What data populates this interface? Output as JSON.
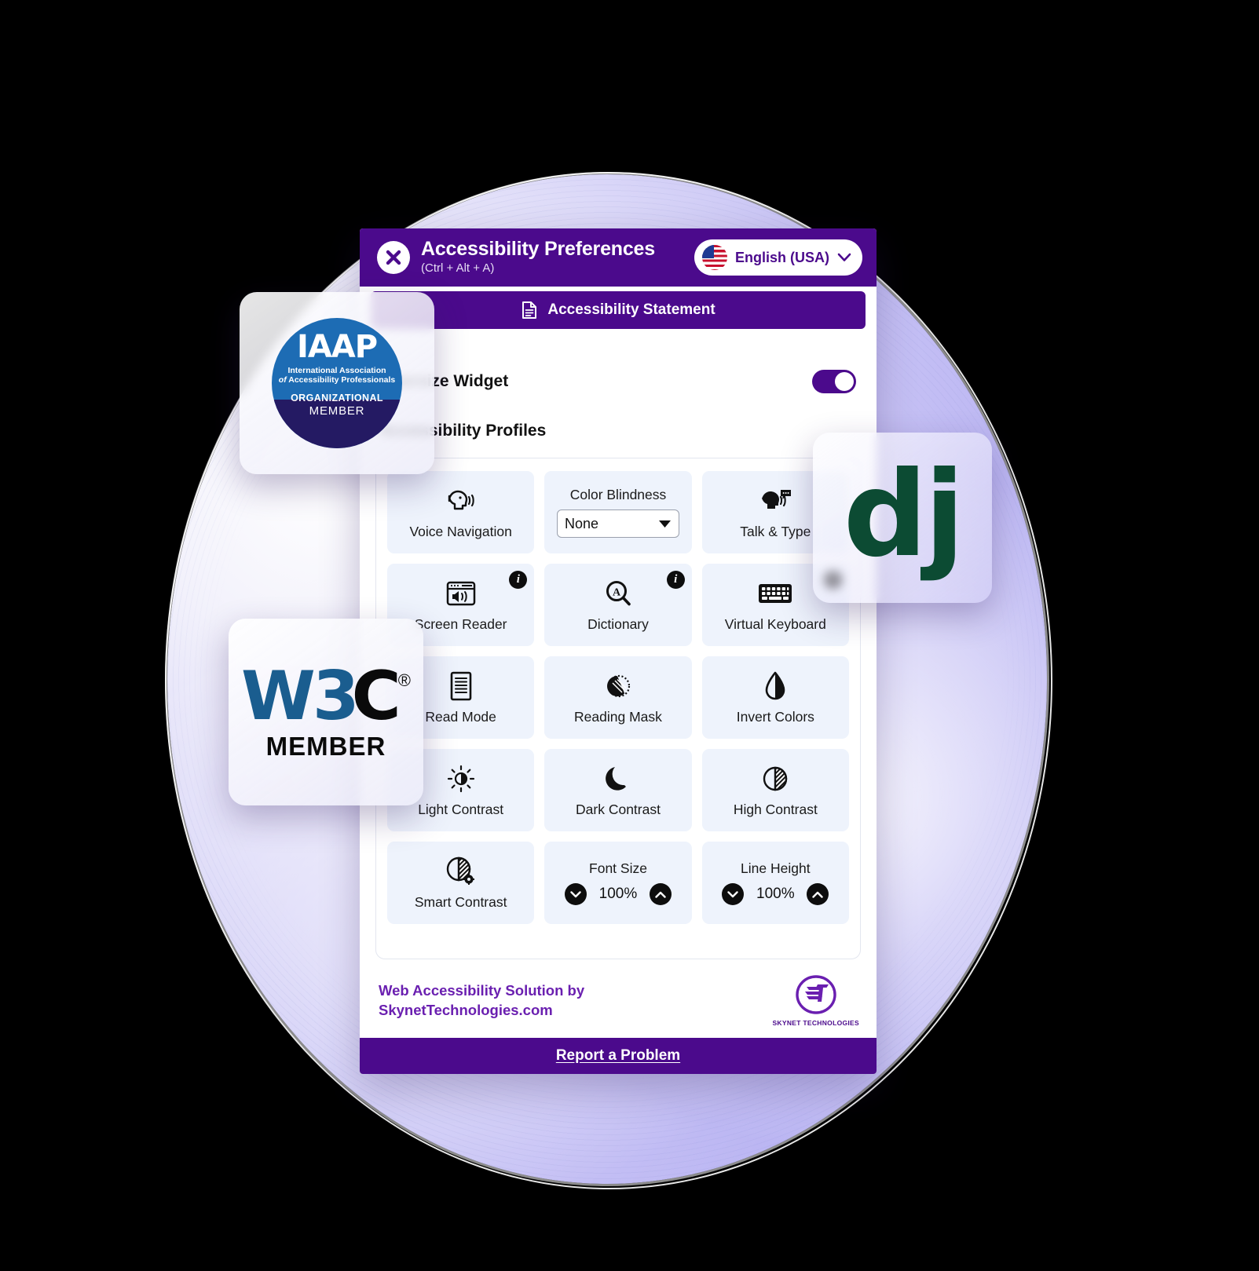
{
  "header": {
    "title": "Accessibility Preferences",
    "shortcut": "(Ctrl + Alt + A)",
    "close_icon": "close-x-icon",
    "language": {
      "label": "English (USA)",
      "flag_icon": "usa-flag-icon",
      "chevron_icon": "chevron-down-icon"
    }
  },
  "statement_button": {
    "label": "Accessibility Statement",
    "icon": "document-icon"
  },
  "settings": {
    "oversize_widget_label": "Oversize Widget",
    "oversize_widget_on": true,
    "profiles_label": "Accessibility Profiles"
  },
  "tiles": [
    {
      "label": "Voice Navigation",
      "icon": "voice-navigation-icon",
      "type": "toggle",
      "info": false
    },
    {
      "label": "Color Blindness",
      "icon": "color-blindness-select",
      "type": "select",
      "value": "None",
      "info": false
    },
    {
      "label": "Talk & Type",
      "icon": "talk-and-type-icon",
      "type": "toggle",
      "info": false
    },
    {
      "label": "Screen Reader",
      "icon": "screen-reader-icon",
      "type": "toggle",
      "info": true
    },
    {
      "label": "Dictionary",
      "icon": "dictionary-icon",
      "type": "toggle",
      "info": true
    },
    {
      "label": "Virtual Keyboard",
      "icon": "virtual-keyboard-icon",
      "type": "toggle",
      "info": true
    },
    {
      "label": "Read Mode",
      "icon": "read-mode-icon",
      "type": "toggle",
      "info": false
    },
    {
      "label": "Reading Mask",
      "icon": "reading-mask-icon",
      "type": "toggle",
      "info": false
    },
    {
      "label": "Invert Colors",
      "icon": "invert-colors-icon",
      "type": "toggle",
      "info": false
    },
    {
      "label": "Light Contrast",
      "icon": "light-contrast-icon",
      "type": "toggle",
      "info": false
    },
    {
      "label": "Dark Contrast",
      "icon": "dark-contrast-icon",
      "type": "toggle",
      "info": false
    },
    {
      "label": "High Contrast",
      "icon": "high-contrast-icon",
      "type": "toggle",
      "info": false
    },
    {
      "label": "Smart Contrast",
      "icon": "smart-contrast-icon",
      "type": "toggle",
      "info": false
    },
    {
      "label": "Font Size",
      "icon": "font-size-stepper",
      "type": "stepper",
      "value": "100%",
      "info": false
    },
    {
      "label": "Line Height",
      "icon": "line-height-stepper",
      "type": "stepper",
      "value": "100%",
      "info": false
    }
  ],
  "footer": {
    "credit_line1": "Web Accessibility Solution by",
    "credit_line2": "SkynetTechnologies.com",
    "logo_mark": "ST",
    "logo_name": "SKYNET TECHNOLOGIES",
    "report_label": "Report a Problem"
  },
  "badges": {
    "iaap": {
      "acronym": "IAAP",
      "line1": "International Association",
      "line2_italic": "of",
      "line2": "Accessibility Professionals",
      "tier": "ORGANIZATIONAL",
      "member": "MEMBER"
    },
    "w3c": {
      "w3": "W3",
      "c": "C",
      "registered": "®",
      "member": "MEMBER"
    },
    "django": {
      "logo": "dj"
    }
  },
  "colors": {
    "brand_purple": "#4B0A8C",
    "tile_bg": "#eef3fc",
    "django_green": "#0C4B33",
    "iaap_blue": "#1d6cb4",
    "iaap_navy": "#241a63",
    "w3c_blue": "#1a5d8f"
  }
}
